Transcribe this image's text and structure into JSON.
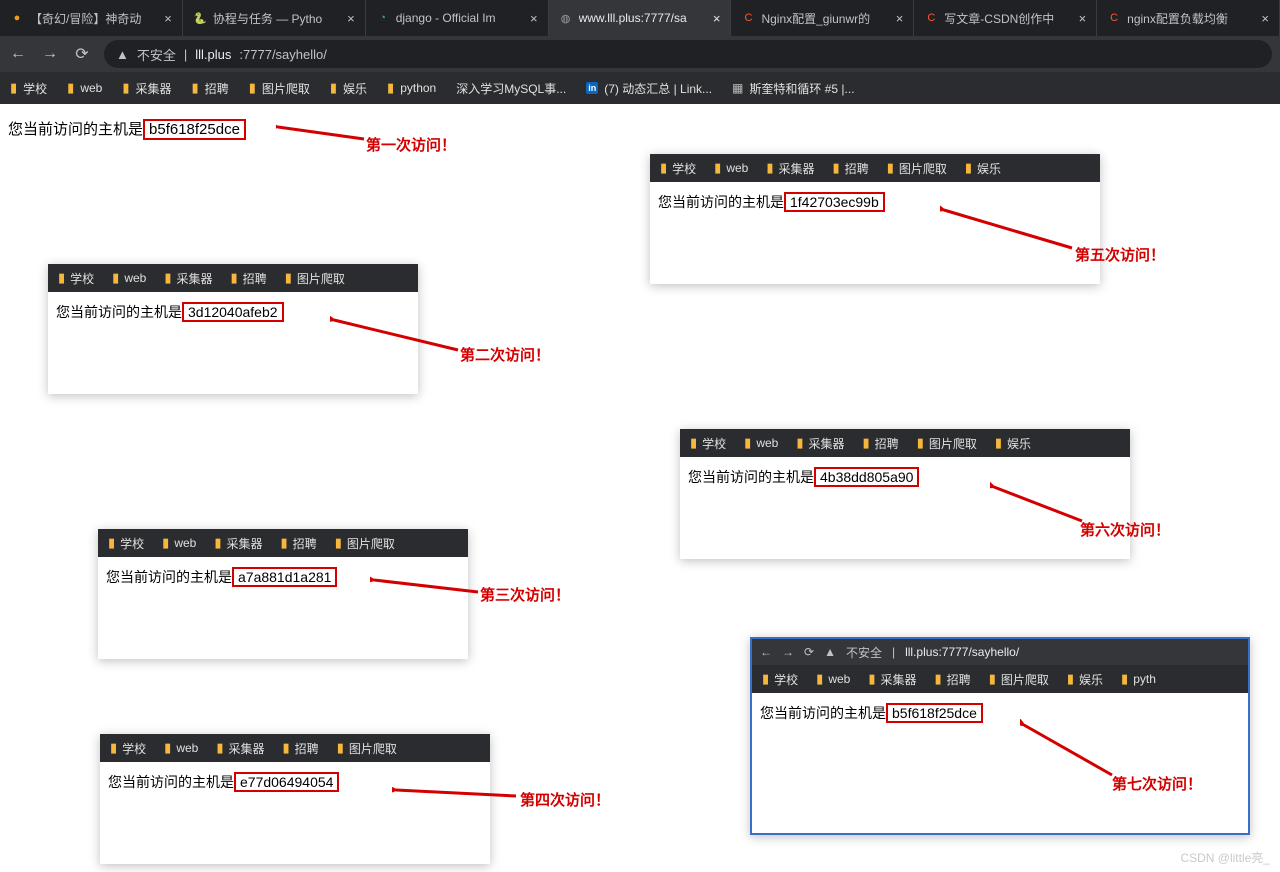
{
  "tabs": [
    {
      "icon": "●",
      "title": "【奇幻/冒险】神奇动",
      "color": "#f39b13"
    },
    {
      "icon": "🐍",
      "title": "协程与任务 — Pytho",
      "color": "#4b8bbe"
    },
    {
      "icon": "◔",
      "title": "django - Official Im",
      "color": "#2aa3b9"
    },
    {
      "icon": "◍",
      "title": "www.lll.plus:7777/sa",
      "color": "#9aa0a6",
      "active": true
    },
    {
      "icon": "C",
      "title": "Nginx配置_giunwr的",
      "color": "#fc5531"
    },
    {
      "icon": "C",
      "title": "写文章-CSDN创作中",
      "color": "#fc5531"
    },
    {
      "icon": "C",
      "title": "nginx配置负载均衡",
      "color": "#fc5531"
    }
  ],
  "toolbar": {
    "warn": "▲",
    "insecure": "不安全",
    "sep": "|",
    "url_host": "lll.plus",
    "url_rest": ":7777/sayhello/"
  },
  "bookmarks": [
    "学校",
    "web",
    "采集器",
    "招聘",
    "图片爬取",
    "娱乐",
    "python"
  ],
  "bookmarks_plain": [
    {
      "txt": "深入学习MySQL事..."
    },
    {
      "txt": "(7) 动态汇总 | Link...",
      "ico": "in"
    },
    {
      "txt": "斯奎特和循环 #5 |...",
      "ico": "qr"
    }
  ],
  "main": {
    "prefix": "您当前访问的主机是",
    "host": "b5f618f25dce"
  },
  "snaps": [
    {
      "id": "s2",
      "bm": [
        "学校",
        "web",
        "采集器",
        "招聘",
        "图片爬取"
      ],
      "prefix": "您当前访问的主机是",
      "host": "3d12040afeb2"
    },
    {
      "id": "s3",
      "bm": [
        "学校",
        "web",
        "采集器",
        "招聘",
        "图片爬取"
      ],
      "prefix": "您当前访问的主机是",
      "host": "a7a881d1a281"
    },
    {
      "id": "s4",
      "bm": [
        "学校",
        "web",
        "采集器",
        "招聘",
        "图片爬取"
      ],
      "prefix": "您当前访问的主机是",
      "host": "e77d06494054"
    },
    {
      "id": "s5",
      "bm": [
        "学校",
        "web",
        "采集器",
        "招聘",
        "图片爬取",
        "娱乐"
      ],
      "prefix": "您当前访问的主机是",
      "host": "1f42703ec99b"
    },
    {
      "id": "s6",
      "bm": [
        "学校",
        "web",
        "采集器",
        "招聘",
        "图片爬取",
        "娱乐"
      ],
      "prefix": "您当前访问的主机是",
      "host": "4b38dd805a90"
    },
    {
      "id": "s7",
      "bm": [
        "学校",
        "web",
        "采集器",
        "招聘",
        "图片爬取",
        "娱乐",
        "pyth"
      ],
      "prefix": "您当前访问的主机是",
      "host": "b5f618f25dce",
      "nav": {
        "warn": "▲",
        "insecure": "不安全",
        "sep": "|",
        "url": "lll.plus:7777/sayhello/"
      }
    }
  ],
  "annots": {
    "a1": "第一次访问！",
    "a2": "第二次访问！",
    "a3": "第三次访问！",
    "a4": "第四次访问！",
    "a5": "第五次访问！",
    "a6": "第六次访问！",
    "a7": "第七次访问！"
  },
  "watermark": "CSDN @little亮_"
}
